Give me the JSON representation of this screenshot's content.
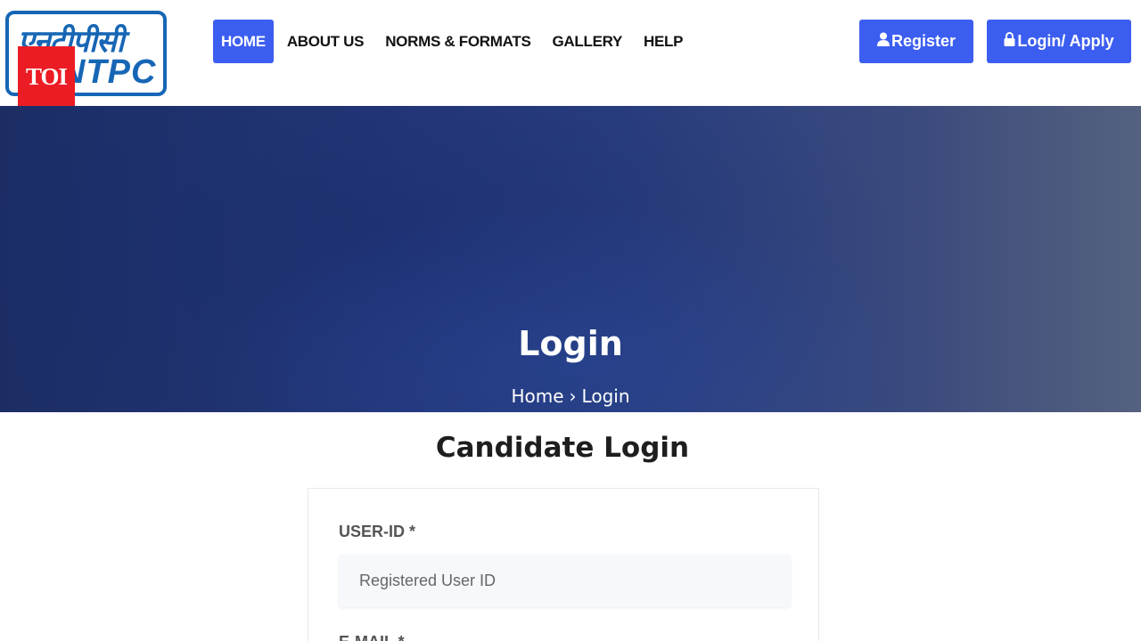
{
  "header": {
    "logo": {
      "hindi_text": "एनटीपीसी",
      "latin_text": "NTPC",
      "badge": "TOI"
    },
    "nav": [
      {
        "label": "HOME",
        "active": true
      },
      {
        "label": "ABOUT US",
        "active": false
      },
      {
        "label": "NORMS & FORMATS",
        "active": false
      },
      {
        "label": "GALLERY",
        "active": false
      },
      {
        "label": "HELP",
        "active": false
      }
    ],
    "register_button": {
      "label": "Register",
      "icon": "user-icon"
    },
    "login_button": {
      "label": "Login/ Apply",
      "icon": "lock-icon"
    }
  },
  "hero": {
    "title": "Login",
    "breadcrumb": [
      "Home",
      "Login"
    ],
    "separator": "›"
  },
  "main": {
    "title": "Candidate Login",
    "form": {
      "user_id_label": "USER-ID *",
      "user_id_placeholder": "Registered User ID",
      "user_id_value": "",
      "email_label": "E-MAIL *"
    }
  },
  "colors": {
    "accent": "#3c5ef0",
    "logo_blue": "#1766b5",
    "badge_red": "#ec1c24",
    "hero_dark": "#1c2d63"
  }
}
